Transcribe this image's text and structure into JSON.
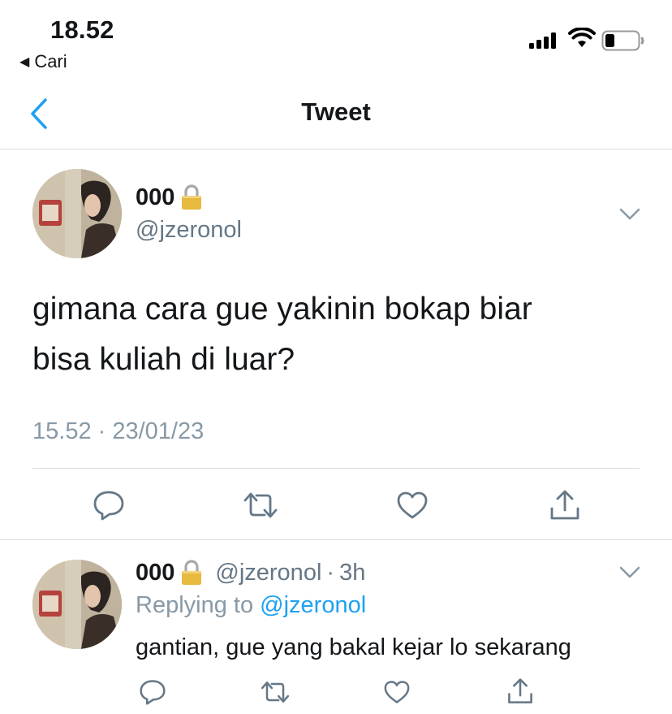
{
  "status_bar": {
    "time": "18.52",
    "back_app_label": "Cari",
    "icons": [
      "signal-icon",
      "wifi-icon",
      "battery-icon"
    ]
  },
  "nav": {
    "title": "Tweet",
    "back_icon": "chevron-left-icon"
  },
  "main_tweet": {
    "display_name": "000",
    "lock_icon": "lock-icon",
    "handle": "@jzeronol",
    "text_line1": "gimana cara gue yakinin bokap biar",
    "text_line2": "bisa kuliah di luar?",
    "timestamp": "15.52 · 23/01/23",
    "actions": [
      "reply-icon",
      "retweet-icon",
      "like-icon",
      "share-icon"
    ]
  },
  "reply_tweet": {
    "display_name": "000",
    "handle": "@jzeronol",
    "separator": "·",
    "age": "3h",
    "replying_prefix": "Replying to",
    "replying_to": "@jzeronol",
    "text": "gantian, gue yang bakal kejar lo sekarang"
  },
  "colors": {
    "accent": "#1da1f2",
    "text": "#14171a",
    "secondary": "#8899a6",
    "divider": "#d8dde2"
  }
}
